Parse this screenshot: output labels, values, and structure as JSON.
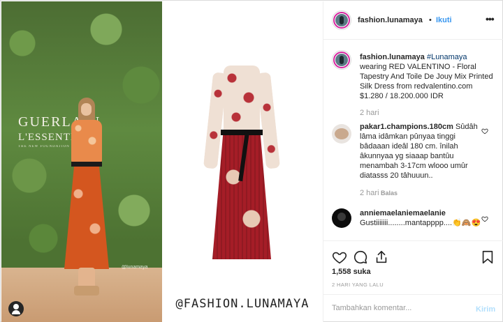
{
  "post": {
    "username": "fashion.lunamaya",
    "separator": "•",
    "follow_label": "Ikuti",
    "more_label": "•••"
  },
  "image": {
    "brand_line1": "GUERLAIN",
    "brand_line2": "L'ESSENTIEL",
    "brand_line3": "THE NEW FOUNDATION",
    "small_watermark": "@lunamaya",
    "big_watermark": "@FASHION.LUNAMAYA"
  },
  "caption": {
    "username": "fashion.lunamaya",
    "hashtag": "#Lunamaya",
    "text": " wearing RED VALENTINO - Floral Tapestry And Toile De Jouy Mix Printed Silk Dress from redvalentino.com $1.280 / 18.200.000 IDR",
    "time": "2 hari"
  },
  "comments": [
    {
      "username": "pakar1.champions.180cm",
      "text": " Sûdâh lâma idâmkan pûnyaa tinggi bâdaaan ideâl 180 cm. înilah âkunnyaa yg siaaap bantûu menambah 3-17cm wlooo umûr diatasss 20 tâhuuun..",
      "time": "2 hari",
      "reply_label": "Balas"
    },
    {
      "username": "anniemaelaniemaelanie",
      "text": " Gustiiiiiii........mantapppp....👏🙈😍"
    }
  ],
  "footer": {
    "likes": "1,558 suka",
    "timestamp": "2 HARI YANG LALU",
    "comment_placeholder": "Tambahkan komentar...",
    "post_label": "Kirim"
  },
  "colors": {
    "accent_blue": "#3897f0",
    "post_disabled": "#b2dffc",
    "muted": "#999999",
    "text": "#262626",
    "border": "#efefef"
  },
  "icons": [
    "heart-icon",
    "comment-icon",
    "share-icon",
    "bookmark-icon",
    "user-tag-icon",
    "like-small-icon"
  ]
}
